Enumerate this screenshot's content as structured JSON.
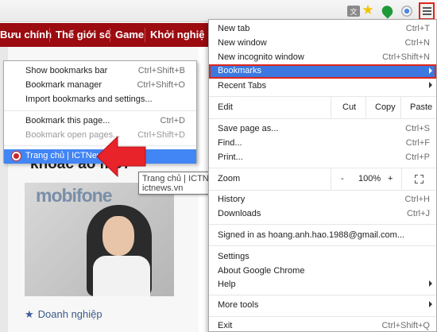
{
  "toolbar": {
    "icons": [
      "translate-icon",
      "star-icon",
      "extension-icon",
      "chrome-remote-icon",
      "hamburger-menu-icon"
    ],
    "accent_color": "#e0241b"
  },
  "site": {
    "nav_items": [
      "Bưu chính",
      "Thế giới số",
      "Game",
      "Khởi nghiệ"
    ],
    "headline": "khoác áo mới",
    "image_logo": "mobifone",
    "category": "Doanh nghiệp"
  },
  "bookmarks_submenu": {
    "items": [
      {
        "label": "Show bookmarks bar",
        "shortcut": "Ctrl+Shift+B"
      },
      {
        "label": "Bookmark manager",
        "shortcut": "Ctrl+Shift+O"
      },
      {
        "label": "Import bookmarks and settings...",
        "shortcut": ""
      },
      {
        "label": "Bookmark this page...",
        "shortcut": "Ctrl+D"
      },
      {
        "label": "Bookmark open pages...",
        "shortcut": "Ctrl+Shift+D"
      },
      {
        "label": "Trang chủ | ICTNews",
        "shortcut": ""
      }
    ]
  },
  "tooltip": {
    "title": "Trang chủ | ICTNews",
    "url": "ictnews.vn"
  },
  "chrome_menu": {
    "new_tab": {
      "label": "New tab",
      "shortcut": "Ctrl+T"
    },
    "new_window": {
      "label": "New window",
      "shortcut": "Ctrl+N"
    },
    "incognito": {
      "label": "New incognito window",
      "shortcut": "Ctrl+Shift+N"
    },
    "bookmarks": {
      "label": "Bookmarks"
    },
    "recent_tabs": {
      "label": "Recent Tabs"
    },
    "edit": {
      "label": "Edit",
      "cut": "Cut",
      "copy": "Copy",
      "paste": "Paste"
    },
    "save_page": {
      "label": "Save page as...",
      "shortcut": "Ctrl+S"
    },
    "find": {
      "label": "Find...",
      "shortcut": "Ctrl+F"
    },
    "print": {
      "label": "Print...",
      "shortcut": "Ctrl+P"
    },
    "zoom": {
      "label": "Zoom",
      "minus": "-",
      "value": "100%",
      "plus": "+"
    },
    "history": {
      "label": "History",
      "shortcut": "Ctrl+H"
    },
    "downloads": {
      "label": "Downloads",
      "shortcut": "Ctrl+J"
    },
    "signed_in": {
      "label": "Signed in as hoang.anh.hao.1988@gmail.com..."
    },
    "settings": {
      "label": "Settings"
    },
    "about": {
      "label": "About Google Chrome"
    },
    "help": {
      "label": "Help"
    },
    "more_tools": {
      "label": "More tools"
    },
    "exit": {
      "label": "Exit",
      "shortcut": "Ctrl+Shift+Q"
    }
  }
}
